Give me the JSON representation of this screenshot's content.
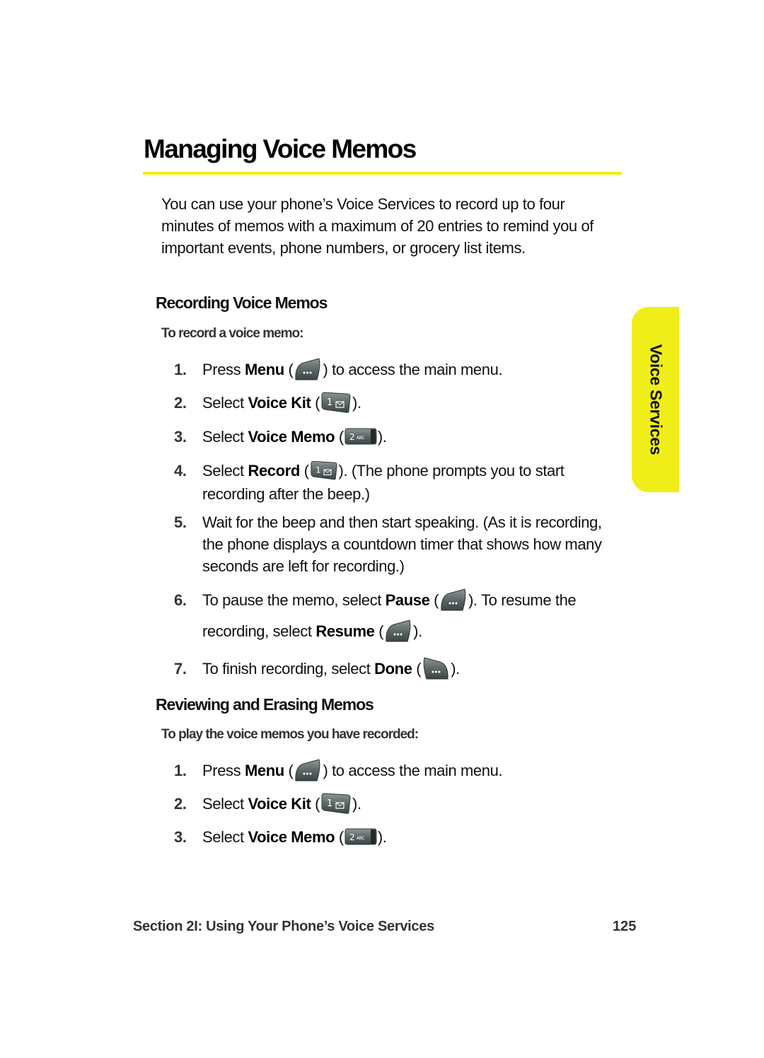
{
  "page": {
    "title": "Managing Voice Memos",
    "intro": "You can use your phone’s Voice Services to record up to four minutes of memos with a maximum of 20 entries to remind you of important events, phone numbers, or grocery list items.",
    "side_tab": "Voice Services",
    "accent_color": "#f2ec10"
  },
  "recording": {
    "heading": "Recording Voice Memos",
    "subheading": "To record a voice memo:",
    "steps": [
      {
        "num": "1.",
        "pre": "Press ",
        "bold": "Menu",
        "mid": " (",
        "icon": "menu-softkey-icon",
        "post": ") to access the main menu."
      },
      {
        "num": "2.",
        "pre": "Select ",
        "bold": "Voice Kit",
        "mid": " (",
        "icon": "key-1-icon",
        "post": ")."
      },
      {
        "num": "3.",
        "pre": "Select ",
        "bold": "Voice Memo",
        "mid": " (",
        "icon": "key-2-abc-icon",
        "post": ")."
      },
      {
        "num": "4.",
        "pre": "Select ",
        "bold": "Record",
        "mid": " (",
        "icon": "key-1-icon",
        "post": "). (The phone prompts you to start recording after the beep.)"
      },
      {
        "num": "5.",
        "text": "Wait for the beep and then start speaking. (As it is recording, the phone displays a countdown timer that shows how many seconds are left for recording.)"
      },
      {
        "num": "6.",
        "pre": "To pause the memo, select ",
        "bold": "Pause",
        "mid": " (",
        "icon": "left-softkey-icon",
        "post": "). To resume the recording, select ",
        "bold2": "Resume",
        "mid2": " (",
        "icon2": "left-softkey-icon",
        "post2": ")."
      },
      {
        "num": "7.",
        "pre": "To finish recording, select ",
        "bold": "Done",
        "mid": " (",
        "icon": "right-softkey-icon",
        "post": ")."
      }
    ]
  },
  "reviewing": {
    "heading": "Reviewing and Erasing Memos",
    "subheading": "To play the voice memos you have recorded:",
    "steps": [
      {
        "num": "1.",
        "pre": "Press ",
        "bold": "Menu",
        "mid": " (",
        "icon": "menu-softkey-icon",
        "post": ") to access the main menu."
      },
      {
        "num": "2.",
        "pre": "Select ",
        "bold": "Voice Kit",
        "mid": " (",
        "icon": "key-1-icon",
        "post": ")."
      },
      {
        "num": "3.",
        "pre": "Select ",
        "bold": "Voice Memo",
        "mid": " (",
        "icon": "key-2-abc-icon",
        "post": ")."
      }
    ]
  },
  "footer": {
    "section": "Section 2I: Using Your Phone’s Voice Services",
    "page_number": "125"
  },
  "keys": {
    "key1_label": "1",
    "key2_label": "2",
    "key2_letters": "ABC",
    "softkey_dots": "•••"
  }
}
